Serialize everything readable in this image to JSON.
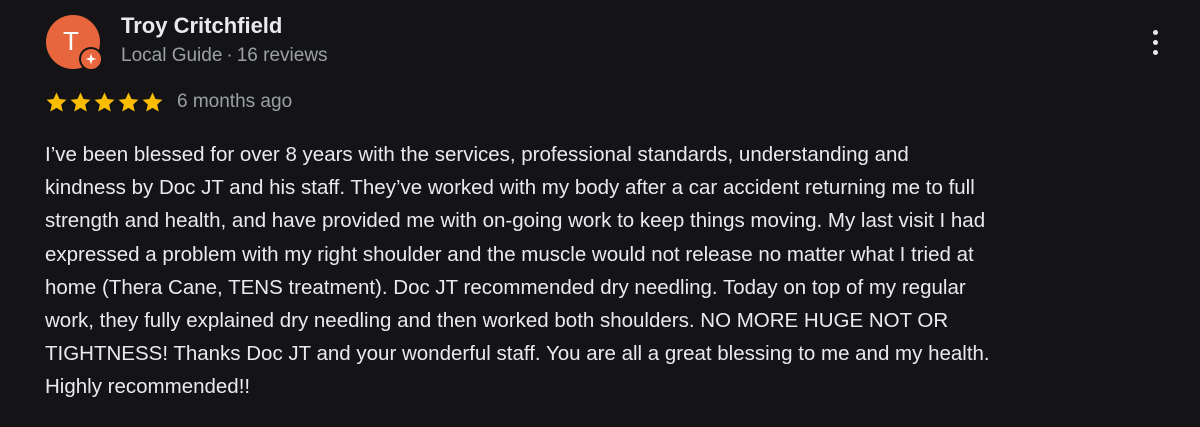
{
  "colors": {
    "background": "#141416",
    "avatar_bg": "#e8663d",
    "badge_bg": "#e8663d",
    "star": "#fbbc04",
    "primary_text": "#e8eaed",
    "secondary_text": "#9aa0a6"
  },
  "reviewer": {
    "initial": "T",
    "name": "Troy Critchfield",
    "role": "Local Guide",
    "separator": "·",
    "review_count": "16 reviews",
    "badge_icon": "local-guide-star-icon"
  },
  "menu": {
    "icon": "more-vert-icon"
  },
  "rating": {
    "stars": 5,
    "max": 5,
    "date": "6 months ago"
  },
  "review": {
    "lines": [
      "I’ve been blessed for over 8 years with the services, professional standards, understanding and",
      "kindness by Doc JT and his staff. They’ve worked with my body after a car accident returning me to full",
      "strength and health, and have provided me with on-going work to keep things moving. My last visit I had",
      "expressed a problem with my right shoulder and the muscle would not release no matter what I tried at",
      "home (Thera Cane, TENS treatment). Doc JT recommended dry needling. Today on top of my regular",
      "work, they fully explained dry needling and then worked both shoulders. NO MORE HUGE NOT OR",
      "TIGHTNESS! Thanks Doc JT and your wonderful staff. You are all a great blessing to me and my health.",
      "Highly recommended!!"
    ]
  }
}
